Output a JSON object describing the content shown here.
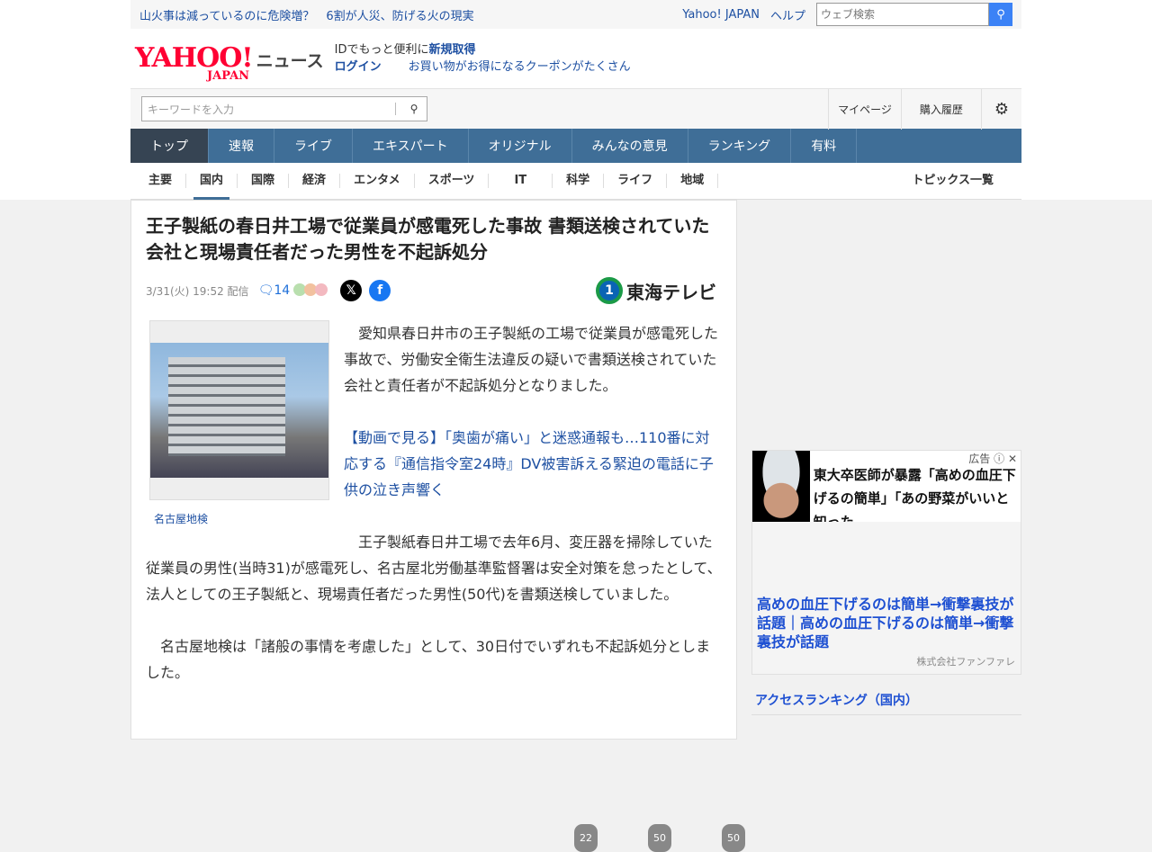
{
  "topbar": {
    "headline": "山火事は減っているのに危険増？　6割が人災、防げる火の現実",
    "yahoo_japan": "Yahoo! JAPAN",
    "help": "ヘルプ",
    "web_search_placeholder": "ウェブ検索"
  },
  "header": {
    "logo": "YAHOO! JAPAN",
    "service": "ニュース",
    "id_text": "IDでもっと便利に",
    "signup": "新規取得",
    "login": "ログイン",
    "coupon": "お買い物がお得になるクーポンがたくさん"
  },
  "search": {
    "placeholder": "キーワードを入力",
    "mypage": "マイページ",
    "history": "購入履歴"
  },
  "nav": [
    "トップ",
    "速報",
    "ライブ",
    "エキスパート",
    "オリジナル",
    "みんなの意見",
    "ランキング",
    "有料"
  ],
  "subnav": [
    "主要",
    "国内",
    "国際",
    "経済",
    "エンタメ",
    "スポーツ",
    "IT",
    "科学",
    "ライフ",
    "地域"
  ],
  "subnav_topics": "トピックス一覧",
  "article": {
    "title": "王子製紙の春日井工場で従業員が感電死した事故 書類送検されていた会社と現場責任者だった男性を不起訴処分",
    "date": "3/31(火) 19:52",
    "delivered": "配信",
    "comments": "14",
    "source": "東海テレビ",
    "photo_caption": "名古屋地検",
    "p1": "　愛知県春日井市の王子製紙の工場で従業員が感電死した事故で、労働安全衛生法違反の疑いで書類送検されていた会社と責任者が不起訴処分となりました。",
    "link": "【動画で見る】「奥歯が痛い」と迷惑通報も…110番に対応する『通信指令室24時』DV被害訴える緊迫の電話に子供の泣き声響く",
    "p2": "　王子製紙春日井工場で去年6月、変圧器を掃除していた従業員の男性(当時31)が感電死し、名古屋北労働基準監督署は安全対策を怠ったとして、法人としての王子製紙と、現場責任者だった男性(50代)を書類送検していました。",
    "p3": "　名古屋地検は「諸般の事情を考慮した」として、30日付でいずれも不起訴処分としました。",
    "reaction_counts": [
      "22",
      "50",
      "50"
    ]
  },
  "ad": {
    "label": "広告",
    "image_text": "東大卒医師が暴露「高めの血圧下げるの簡単」「あの野菜がいいと知った",
    "title": "高めの血圧下げるのは簡単→衝撃裏技が話題｜高めの血圧下げるのは簡単→衝撃裏技が話題",
    "company": "株式会社ファンファレ"
  },
  "ranking": {
    "title": "アクセスランキング（国内）"
  }
}
